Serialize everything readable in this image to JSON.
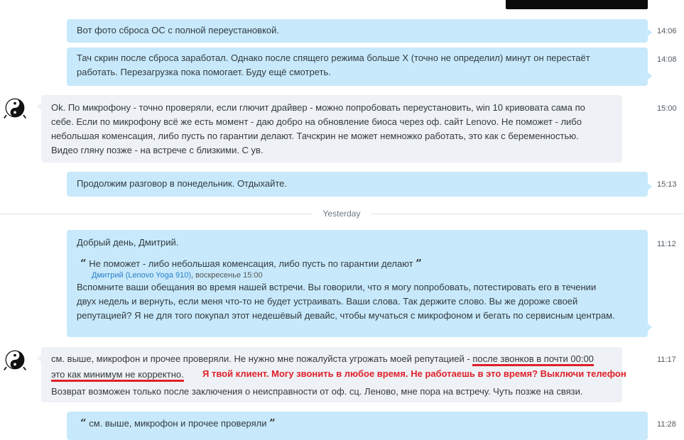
{
  "messages": [
    {
      "text": "Вот фото сброса ОС с полной переустановкой.",
      "time": "14:06"
    },
    {
      "line1": "Тач скрин после сброса заработал. Однако после спящего режима больше Х (точно не определил) минут он перестаёт",
      "line2": "работать. Перезагрузка пока помогает. Буду ещё смотреть.",
      "time": "14:08"
    },
    {
      "line1": "Ok. По микрофону - точно проверяли, если глючит драйвер - можно попробовать переустановить, win 10 кривовата сама по",
      "line2": "себе. Если по микрофону всё же есть момент - даю добро на обновление биоса через оф. сайт Lenovo. Не поможет - либо",
      "line3": "небольшая коменсация, либо пусть по гарантии делают. Тачскрин не может немножко работать, это как с беременностью.",
      "line4": "Видео гляну позже - на встрече с близкими. С ув.",
      "time": "15:00"
    },
    {
      "text": "Продолжим разговор в понедельник. Отдыхайте.",
      "time": "15:13"
    },
    {
      "greeting": "Добрый день, Дмитрий.",
      "quote_text": "Не поможет - либо небольшая коменсация, либо пусть по гарантии делают",
      "quote_author": "Дмитрий (Lenovo Yoga 910)",
      "quote_date": ", воскресенье 15:00",
      "line1": "Вспомните ваши обещания во время нашей встречи. Вы говорили, что я могу попробовать, потестировать его в течении",
      "line2": "двух недель и вернуть, если меня что-то не будет устраивать. Ваши слова. Так держите слово. Вы же дороже своей",
      "line3": "репутацией? Я не для того покупал этот недешёвый девайс, чтобы мучаться с микрофоном и бегать по сервисным центрам.",
      "time": "11:12"
    },
    {
      "part1": "см. выше, микрофон и прочее проверяли. Не нужно мне пожалуйста угрожать моей репутацией - ",
      "part2": "после звонков в почти 00:00",
      "part3": "это как минимум не корректно.",
      "line3": "Возврат возможен только после заключения о неисправности от оф. сц. Леново, мне пора на встречу. Чуть позже на связи.",
      "time": "11:17"
    },
    {
      "text": "см. выше, микрофон и прочее проверяли",
      "time": "11:28"
    }
  ],
  "separator": {
    "label": "Yesterday"
  },
  "annotation": "Я твой клиент. Могу звонить в любое время. Не работаешь в это время? Выключи телефон",
  "quote_marks": {
    "open": "“",
    "close": "”"
  },
  "colors": {
    "outgoing": "#c7e9fb",
    "incoming": "#eef1f5",
    "annotation": "#e0202a",
    "link": "#2c80c8"
  },
  "icons": {
    "avatar": "yin-yang-icon"
  }
}
